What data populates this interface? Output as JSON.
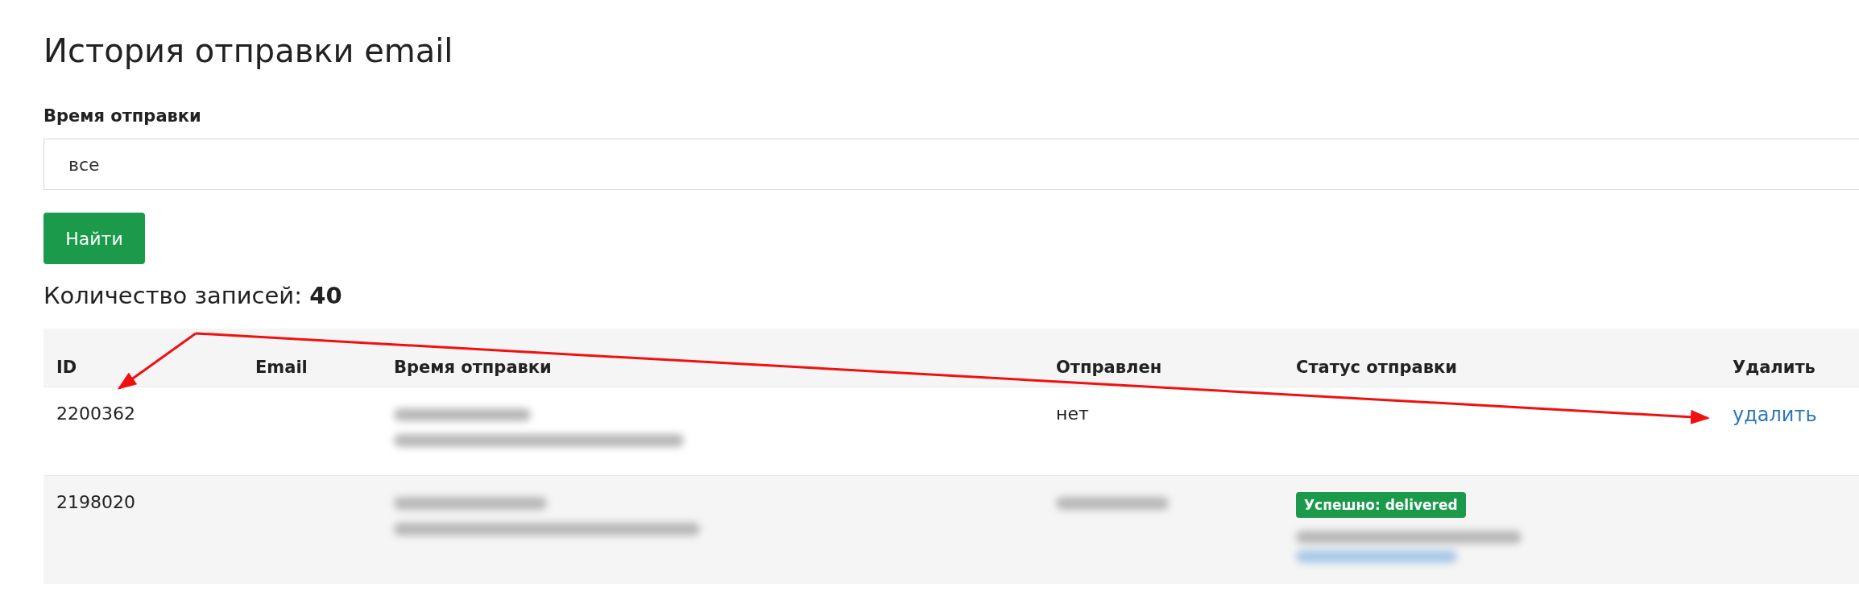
{
  "title": "История отправки email",
  "filter": {
    "label": "Время отправки",
    "value": "все"
  },
  "search_button": "Найти",
  "count": "Количество записей: **40**",
  "table": {
    "columns": [
      "ID",
      "Email",
      "Время отправки",
      "Отправлен",
      "Статус отправки",
      "Удалить"
    ],
    "rows": [
      {
        "id": "2200362",
        "sent": "нет",
        "delete_link": "удалить"
      },
      {
        "id": "2198020",
        "status_badge": "Успешно: delivered"
      }
    ]
  }
}
